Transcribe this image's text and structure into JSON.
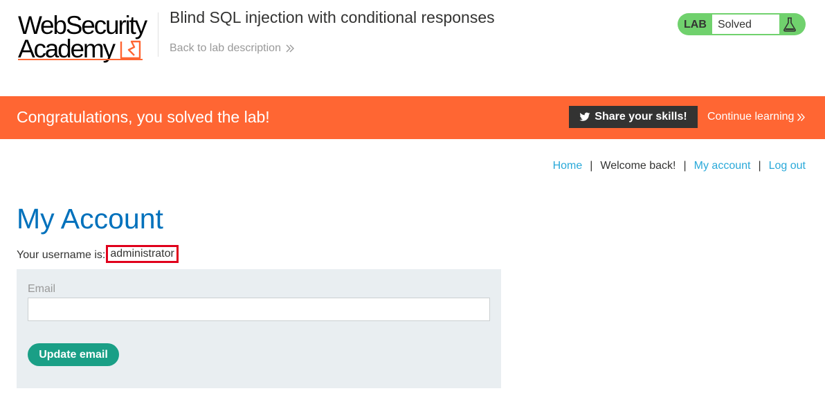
{
  "header": {
    "logo_line1": "WebSecurity",
    "logo_line2": "Academy",
    "lab_title": "Blind SQL injection with conditional responses",
    "back_link": "Back to lab description",
    "lab_badge": "LAB",
    "lab_status": "Solved"
  },
  "banner": {
    "message": "Congratulations, you solved the lab!",
    "share_label": "Share your skills!",
    "continue_label": "Continue learning"
  },
  "nav": {
    "home": "Home",
    "welcome": "Welcome back!",
    "my_account": "My account",
    "log_out": "Log out",
    "separator": "|"
  },
  "main": {
    "title": "My Account",
    "username_label": "Your username is:",
    "username_value": "administrator",
    "email_label": "Email",
    "email_value": "",
    "update_button": "Update email"
  },
  "colors": {
    "accent_orange": "#ff6633",
    "link_blue": "#29a9d9",
    "title_blue": "#0071bc",
    "solved_green": "#70d16d",
    "button_teal": "#1a9f86",
    "highlight_red": "#e0001b"
  }
}
